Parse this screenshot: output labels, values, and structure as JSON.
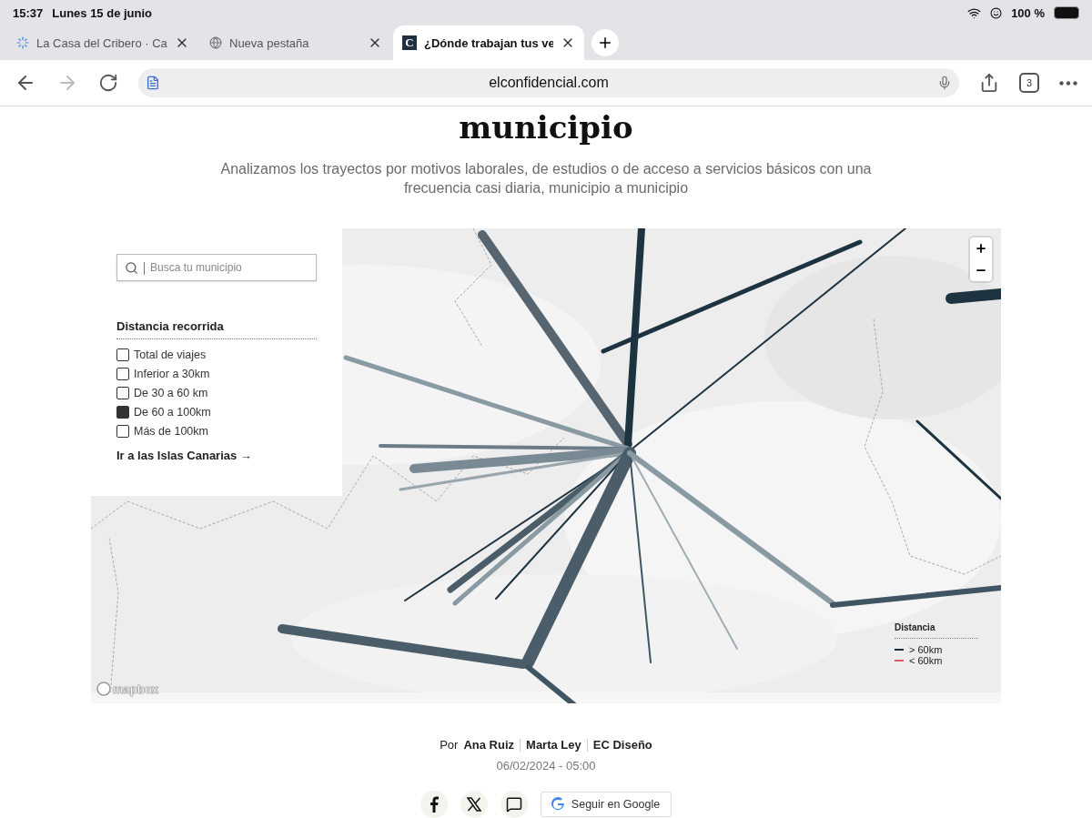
{
  "status_bar": {
    "time": "15:37",
    "date": "Lunes 15 de junio",
    "battery": "100 %"
  },
  "tabs": [
    {
      "kind": "loading",
      "title": "La Casa del Cribero · Ca",
      "selected": false
    },
    {
      "kind": "globe",
      "title": "Nueva pestaña",
      "selected": false
    },
    {
      "kind": "site",
      "logo": "C",
      "title": "¿Dónde trabajan tus ve",
      "selected": true
    }
  ],
  "address_bar": {
    "url": "elconfidencial.com",
    "tab_count": "3"
  },
  "article": {
    "heading": "municipio",
    "subtitle": "Analizamos los trayectos por motivos laborales, de estudios o de acceso a servicios básicos con una frecuencia casi diaria, municipio a municipio",
    "map": {
      "search": {
        "placeholder": "Busca tu municipio"
      },
      "filter": {
        "title": "Distancia recorrida",
        "options": [
          {
            "label": "Total de viajes",
            "checked": false
          },
          {
            "label": "Inferior a 30km",
            "checked": false
          },
          {
            "label": "De 30 a 60 km",
            "checked": false
          },
          {
            "label": "De 60 a 100km",
            "checked": true
          },
          {
            "label": "Más de 100km",
            "checked": false
          }
        ],
        "link": "Ir a las Islas Canarias →"
      },
      "legend": {
        "title": "Distancia",
        "items": [
          {
            "label": "> 60km",
            "color": "#1c2b36"
          },
          {
            "label": "< 60km",
            "color": "#e05a6a"
          }
        ]
      },
      "attribution": "mapbox"
    },
    "byline": {
      "prefix": "Por",
      "authors": [
        "Ana Ruiz",
        "Marta Ley",
        "EC Diseño"
      ]
    },
    "date": "06/02/2024 - 05:00",
    "follow_button": "Seguir en Google"
  }
}
